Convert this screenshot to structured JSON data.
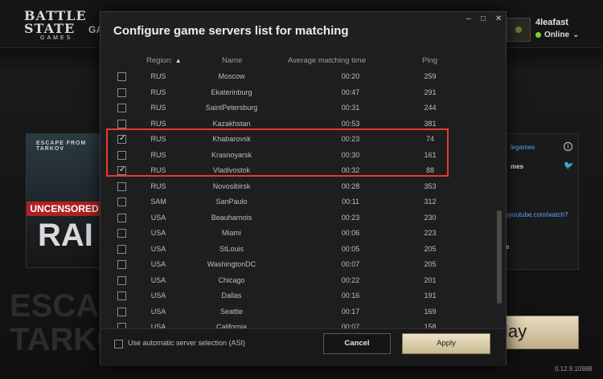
{
  "launcher": {
    "logo_line1": "BATTLE STATE",
    "logo_line2": "GAMES",
    "tab_partial": "GA",
    "user": {
      "name": "4leafast",
      "status": "Online"
    },
    "banner": {
      "top": "ESCAPE FROM TARKOV",
      "red": "UNCENSORED",
      "big": "RAI"
    },
    "bg_logo": "ESCAPE TARKO",
    "right_panel": {
      "link1": "legames",
      "text2": "mes",
      "link3": "yyoutube.com/watch?",
      "text4": "e"
    },
    "play_label": "lay",
    "version": "0.12.9.10988"
  },
  "modal": {
    "title": "Configure game servers list for matching",
    "window_buttons": {
      "minimize": "–",
      "maximize": "□",
      "close": "✕"
    },
    "columns": {
      "region": "Region:",
      "name": "Name",
      "time": "Average matching time",
      "ping": "Ping"
    },
    "servers": [
      {
        "checked": false,
        "region": "RUS",
        "name": "Moscow",
        "time": "00:20",
        "ping": "259"
      },
      {
        "checked": false,
        "region": "RUS",
        "name": "Ekaterinburg",
        "time": "00:47",
        "ping": "291"
      },
      {
        "checked": false,
        "region": "RUS",
        "name": "SaintPetersburg",
        "time": "00:31",
        "ping": "244"
      },
      {
        "checked": false,
        "region": "RUS",
        "name": "Kazakhstan",
        "time": "00:53",
        "ping": "381"
      },
      {
        "checked": true,
        "region": "RUS",
        "name": "Khabarovsk",
        "time": "00:23",
        "ping": "74"
      },
      {
        "checked": false,
        "region": "RUS",
        "name": "Krasnoyarsk",
        "time": "00:30",
        "ping": "161"
      },
      {
        "checked": true,
        "region": "RUS",
        "name": "Vladivostok",
        "time": "00:32",
        "ping": "88"
      },
      {
        "checked": false,
        "region": "RUS",
        "name": "Novosibirsk",
        "time": "00:28",
        "ping": "353"
      },
      {
        "checked": false,
        "region": "SAM",
        "name": "SanPaulo",
        "time": "00:11",
        "ping": "312"
      },
      {
        "checked": false,
        "region": "USA",
        "name": "Beauharnois",
        "time": "00:23",
        "ping": "230"
      },
      {
        "checked": false,
        "region": "USA",
        "name": "Miami",
        "time": "00:06",
        "ping": "223"
      },
      {
        "checked": false,
        "region": "USA",
        "name": "StLouis",
        "time": "00:05",
        "ping": "205"
      },
      {
        "checked": false,
        "region": "USA",
        "name": "WashingtonDC",
        "time": "00:07",
        "ping": "205"
      },
      {
        "checked": false,
        "region": "USA",
        "name": "Chicago",
        "time": "00:22",
        "ping": "201"
      },
      {
        "checked": false,
        "region": "USA",
        "name": "Dallas",
        "time": "00:16",
        "ping": "191"
      },
      {
        "checked": false,
        "region": "USA",
        "name": "Seattle",
        "time": "00:17",
        "ping": "169"
      },
      {
        "checked": false,
        "region": "USA",
        "name": "California",
        "time": "00:07",
        "ping": "158"
      }
    ],
    "asi_label": "Use automatic server selection (ASI)",
    "cancel_label": "Cancel",
    "apply_label": "Apply"
  },
  "colors": {
    "highlight": "#e23b36",
    "online": "#7fd02a",
    "apply": "#d9cca6"
  }
}
